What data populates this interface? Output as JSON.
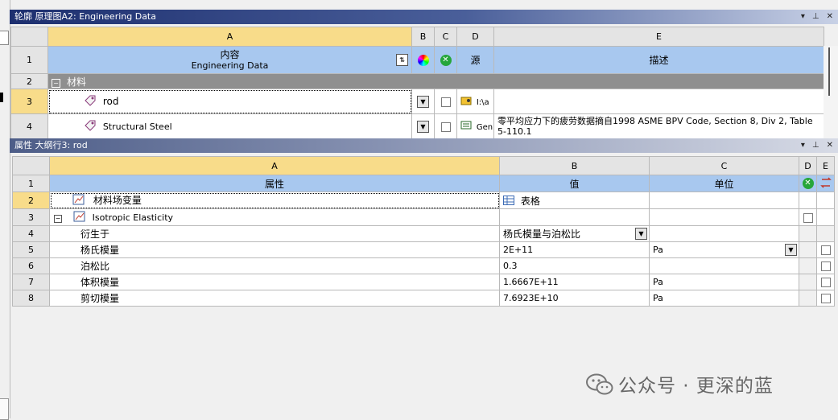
{
  "upper_panel": {
    "title": "轮廓 原理图A2: Engineering Data",
    "title_buttons": [
      "▾",
      "⊥",
      "✕"
    ],
    "columns": [
      "A",
      "B",
      "C",
      "D",
      "E"
    ],
    "row1": {
      "num": "1",
      "content_cn": "内容",
      "content_en": "Engineering Data",
      "source": "源",
      "description": "描述"
    },
    "row2": {
      "num": "2",
      "label": "材料",
      "toggle": "⊟"
    },
    "row3": {
      "num": "3",
      "name": "rod",
      "source": "I:\\a"
    },
    "row4": {
      "num": "4",
      "name": "Structural Steel",
      "source": "Gen",
      "description": "零平均应力下的疲劳数据摘自1998 ASME BPV Code, Section 8, Div 2, Table 5-110.1"
    }
  },
  "lower_panel": {
    "title": "属性 大纲行3: rod",
    "title_buttons": [
      "▾",
      "⊥",
      "✕"
    ],
    "columns": [
      "A",
      "B",
      "C",
      "D",
      "E"
    ],
    "header_row": {
      "num": "1",
      "property": "属性",
      "value": "值",
      "unit": "单位"
    },
    "rows": [
      {
        "num": "2",
        "property": "材料场变量",
        "value": "表格",
        "unit": ""
      },
      {
        "num": "3",
        "property": "Isotropic Elasticity",
        "toggle": "⊟",
        "value": "",
        "unit": ""
      },
      {
        "num": "4",
        "property": "衍生于",
        "value": "杨氏模量与泊松比",
        "unit": ""
      },
      {
        "num": "5",
        "property": "杨氏模量",
        "value": "2E+11",
        "unit": "Pa"
      },
      {
        "num": "6",
        "property": "泊松比",
        "value": "0.3",
        "unit": ""
      },
      {
        "num": "7",
        "property": "体积模量",
        "value": "1.6667E+11",
        "unit": "Pa"
      },
      {
        "num": "8",
        "property": "剪切模量",
        "value": "7.6923E+10",
        "unit": "Pa"
      }
    ]
  },
  "watermark": "公众号 · 更深的蓝",
  "icons": {
    "material": "material-tag-icon",
    "property": "property-chart-icon",
    "table": "table-icon",
    "refresh": "refresh-icon",
    "delete": "delete-green-icon",
    "color": "color-wheel-icon"
  },
  "colors": {
    "title_bar": "#1d2f6f",
    "header_blue": "#a8c8ef",
    "selected_header": "#f8dc8a",
    "group_row": "#8f8f8f"
  }
}
